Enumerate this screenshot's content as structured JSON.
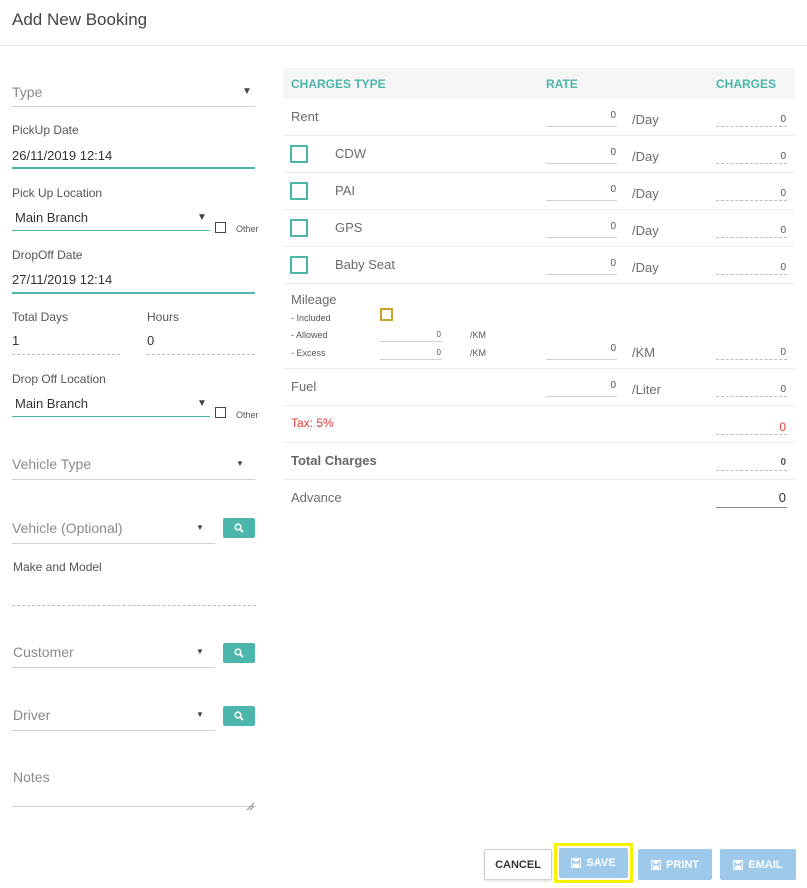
{
  "header": {
    "title": "Add New Booking"
  },
  "left": {
    "type": {
      "placeholder": "Type"
    },
    "pickup_date": {
      "label": "PickUp Date",
      "value": "26/11/2019 12:14"
    },
    "pickup_location": {
      "label": "Pick Up Location",
      "value": "Main Branch",
      "other": "Other"
    },
    "dropoff_date": {
      "label": "DropOff Date",
      "value": "27/11/2019 12:14"
    },
    "total_days": {
      "label": "Total Days",
      "value": "1"
    },
    "hours": {
      "label": "Hours",
      "value": "0"
    },
    "dropoff_location": {
      "label": "Drop Off Location",
      "value": "Main Branch",
      "other": "Other"
    },
    "vehicle_type": {
      "placeholder": "Vehicle Type"
    },
    "vehicle": {
      "placeholder": "Vehicle (Optional)"
    },
    "make_model": {
      "label": "Make and Model"
    },
    "customer": {
      "placeholder": "Customer"
    },
    "driver": {
      "placeholder": "Driver"
    },
    "notes": {
      "placeholder": "Notes"
    }
  },
  "charges": {
    "headers": {
      "type": "CHARGES TYPE",
      "rate": "RATE",
      "charges": "CHARGES"
    },
    "rent": {
      "label": "Rent",
      "rate": "0",
      "unit": "/Day",
      "charge": "0"
    },
    "cdw": {
      "label": "CDW",
      "rate": "0",
      "unit": "/Day",
      "charge": "0"
    },
    "pai": {
      "label": "PAI",
      "rate": "0",
      "unit": "/Day",
      "charge": "0"
    },
    "gps": {
      "label": "GPS",
      "rate": "0",
      "unit": "/Day",
      "charge": "0"
    },
    "baby_seat": {
      "label": "Baby Seat",
      "rate": "0",
      "unit": "/Day",
      "charge": "0"
    },
    "mileage": {
      "label": "Mileage",
      "included": "- Included",
      "allowed": "- Allowed",
      "allowed_value": "0",
      "allowed_unit": "/KM",
      "excess": "- Excess",
      "excess_value": "0",
      "excess_unit": "/KM",
      "rate": "0",
      "unit": "/KM",
      "charge": "0"
    },
    "fuel": {
      "label": "Fuel",
      "rate": "0",
      "unit": "/Liter",
      "charge": "0"
    },
    "tax": {
      "label": "Tax: 5%",
      "charge": "0",
      "color": "#e53935"
    },
    "total": {
      "label": "Total Charges",
      "charge": "0"
    },
    "advance": {
      "label": "Advance",
      "value": "0"
    }
  },
  "footer": {
    "cancel": "CANCEL",
    "save": "SAVE",
    "print": "PRINT",
    "email": "EMAIL"
  },
  "icons": {
    "search": "search-icon",
    "save": "floppy-icon"
  },
  "colors": {
    "accent": "#4db6ac",
    "button": "#5fa8e0",
    "highlight": "#f6f200",
    "mileage_check": "#c9a227"
  }
}
